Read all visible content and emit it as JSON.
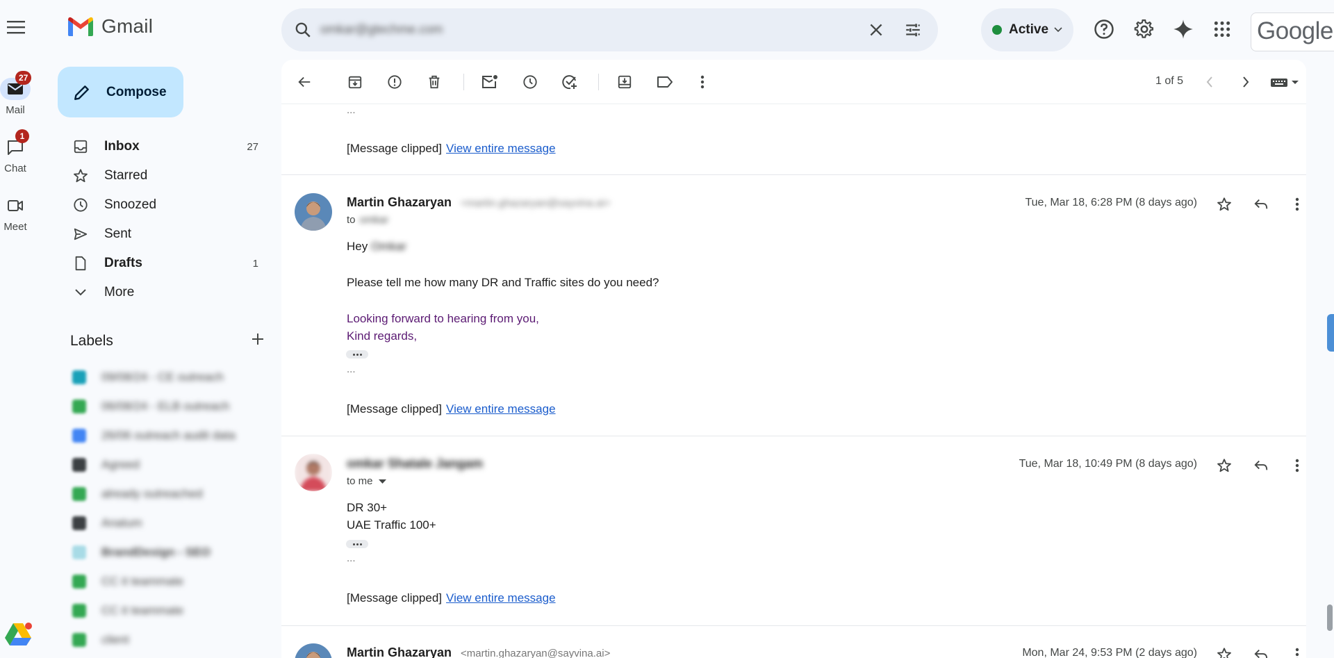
{
  "header": {
    "app_name": "Gmail",
    "search_value": "omkar@gtechme.com",
    "status": "Active",
    "brand": "Google"
  },
  "rail": {
    "mail": {
      "label": "Mail",
      "badge": "27"
    },
    "chat": {
      "label": "Chat",
      "badge": "1"
    },
    "meet": {
      "label": "Meet"
    }
  },
  "compose_label": "Compose",
  "nav": [
    {
      "label": "Inbox",
      "count": "27"
    },
    {
      "label": "Starred",
      "count": ""
    },
    {
      "label": "Snoozed",
      "count": ""
    },
    {
      "label": "Sent",
      "count": ""
    },
    {
      "label": "Drafts",
      "count": "1"
    },
    {
      "label": "More",
      "count": ""
    }
  ],
  "labels": {
    "title": "Labels",
    "items": [
      {
        "name": "09/08/24 - CE outreach",
        "color": "#1aa1b8"
      },
      {
        "name": "06/08/24 - ELB outreach",
        "color": "#34a853"
      },
      {
        "name": "26/06 outreach audit data",
        "color": "#4285f4"
      },
      {
        "name": "Agreed",
        "color": "#3c4043"
      },
      {
        "name": "already outreached",
        "color": "#34a853"
      },
      {
        "name": "Anatum",
        "color": "#3c4043"
      },
      {
        "name": "BrandDesign - SEO",
        "color": "#a8dbe6"
      },
      {
        "name": "CC it teammate",
        "color": "#34a853"
      },
      {
        "name": "CC it teammate",
        "color": "#34a853"
      },
      {
        "name": "client",
        "color": "#34a853"
      }
    ]
  },
  "toolbar": {
    "pager": "1 of 5"
  },
  "thread": {
    "top_clipped": {
      "ellipsis": "...",
      "text": "[Message clipped]",
      "link": "View entire message"
    },
    "messages": [
      {
        "sender": "Martin Ghazaryan",
        "email": "<martin.ghazaryan@sayvina.ai>",
        "to": "to",
        "to_name": "omkar",
        "date": "Tue, Mar 18, 6:28 PM (8 days ago)",
        "greeting": "Hey",
        "greeting_name": "Omkar",
        "lines": [
          "Please tell me how many DR and Traffic sites do you need?"
        ],
        "signoff": [
          "Looking forward to hearing from you,",
          "Kind regards,"
        ],
        "ellipsis": "...",
        "clipped": "[Message clipped]",
        "link": "View entire message"
      },
      {
        "sender": "omkar Shatale Jangam",
        "to": "to me",
        "date": "Tue, Mar 18, 10:49 PM (8 days ago)",
        "lines": [
          "DR 30+",
          "UAE Traffic 100+"
        ],
        "ellipsis": "...",
        "clipped": "[Message clipped]",
        "link": "View entire message"
      },
      {
        "sender": "Martin Ghazaryan",
        "email": "<martin.ghazaryan@sayvina.ai>",
        "date": "Mon, Mar 24, 9:53 PM (2 days ago)"
      }
    ]
  }
}
